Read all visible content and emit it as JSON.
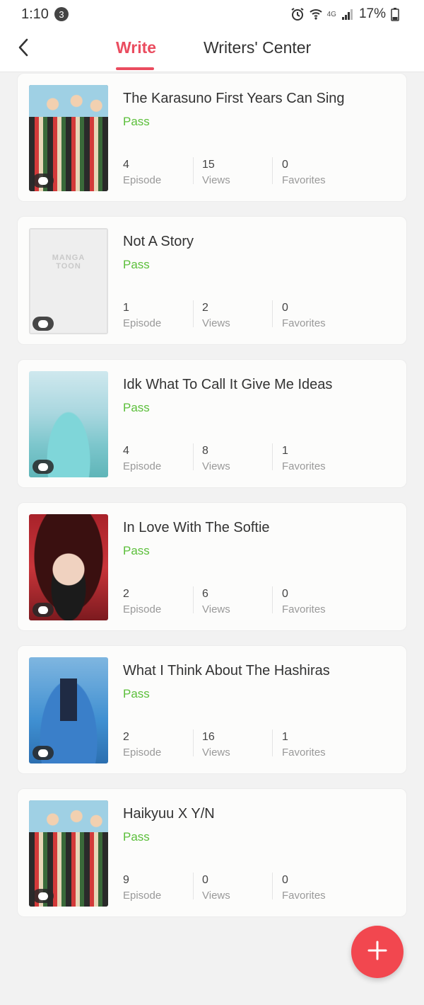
{
  "status_bar": {
    "time": "1:10",
    "notification_count": "3",
    "network": "4G",
    "battery": "17%"
  },
  "header": {
    "tabs": [
      {
        "label": "Write",
        "active": true
      },
      {
        "label": "Writers' Center",
        "active": false
      }
    ]
  },
  "stories": [
    {
      "title": "The Karasuno First Years Can Sing",
      "status": "Pass",
      "episodes": "4",
      "views": "15",
      "favorites": "0",
      "cover": "anime-team-cover"
    },
    {
      "title": "Not A Story",
      "status": "Pass",
      "episodes": "1",
      "views": "2",
      "favorites": "0",
      "cover": "mangatoon-placeholder"
    },
    {
      "title": "Idk What To Call It Give Me Ideas",
      "status": "Pass",
      "episodes": "4",
      "views": "8",
      "favorites": "1",
      "cover": "waterfall-cover"
    },
    {
      "title": "In Love With The Softie",
      "status": "Pass",
      "episodes": "2",
      "views": "6",
      "favorites": "0",
      "cover": "red-hood-girl-cover"
    },
    {
      "title": "What I Think About The Hashiras",
      "status": "Pass",
      "episodes": "2",
      "views": "16",
      "favorites": "1",
      "cover": "blue-swordsman-cover"
    },
    {
      "title": "Haikyuu X Y/N",
      "status": "Pass",
      "episodes": "9",
      "views": "0",
      "favorites": "0",
      "cover": "anime-team-cover"
    }
  ],
  "labels": {
    "episode": "Episode",
    "views": "Views",
    "favorites": "Favorites",
    "placeholder_line1": "MANGA",
    "placeholder_line2": "TOON"
  },
  "colors": {
    "accent": "#ea4c5f",
    "pass": "#5bbf3a",
    "fab": "#f2474f"
  }
}
